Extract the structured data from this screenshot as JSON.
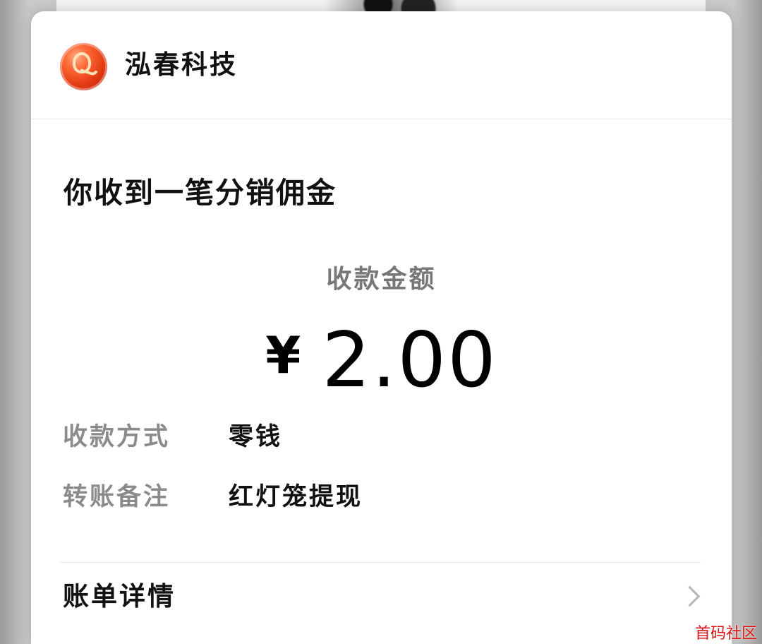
{
  "header": {
    "brand_name": "泓春科技",
    "logo_icon": "qq-like-red-logo-icon"
  },
  "message": {
    "title": "你收到一笔分销佣金",
    "amount_label": "收款金额",
    "currency": "¥",
    "amount": "2.00"
  },
  "details": [
    {
      "label": "收款方式",
      "value": "零钱"
    },
    {
      "label": "转账备注",
      "value": "红灯笼提现"
    }
  ],
  "footer": {
    "bill_details_label": "账单详情",
    "chevron_icon": "chevron-right-icon"
  },
  "watermark": "首码社区",
  "colors": {
    "primary_text": "#111111",
    "secondary_text": "#8b8b8b",
    "watermark": "#dd1111",
    "logo": "#e23a12"
  }
}
